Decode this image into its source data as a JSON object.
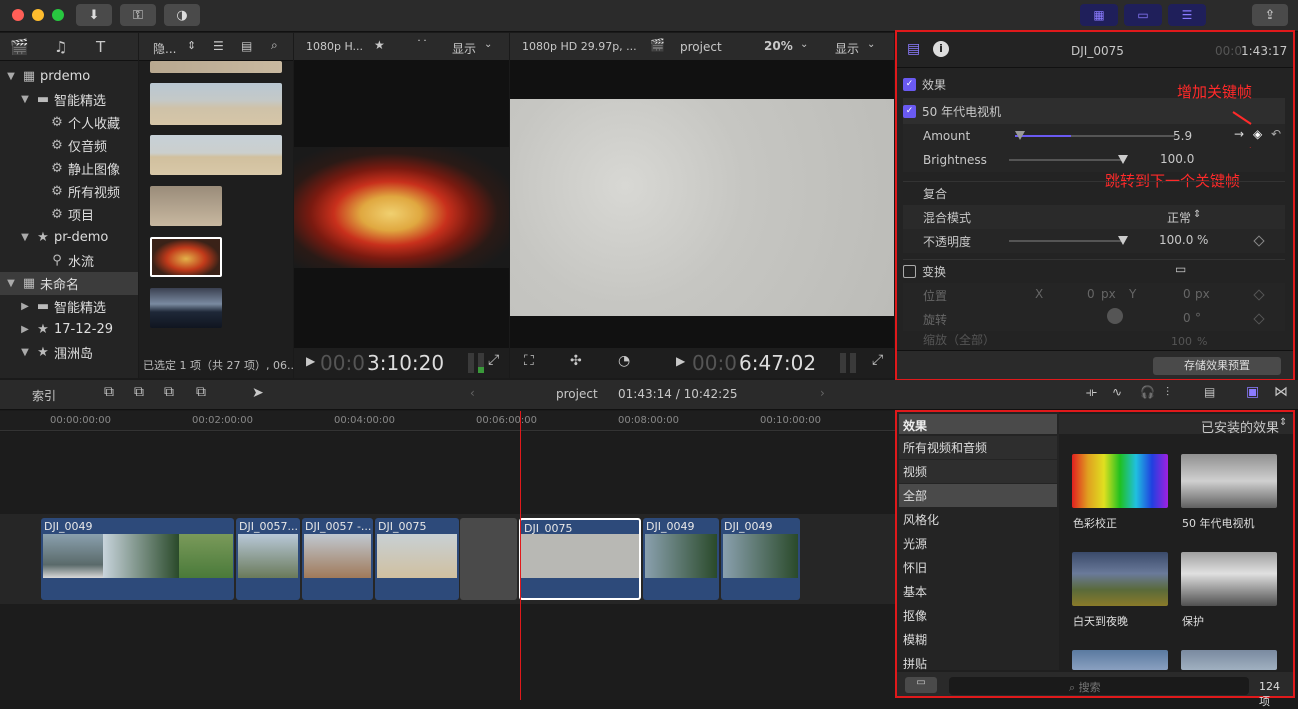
{
  "toolbar": {
    "buttons": [
      "download-icon",
      "key-icon",
      "clock-icon"
    ],
    "share": "share-icon"
  },
  "library": {
    "tools": [
      "clapboard-icon",
      "music-icon",
      "title-icon"
    ],
    "items": [
      {
        "label": "prdemo",
        "indent": 0,
        "expanded": true,
        "icon": "grid"
      },
      {
        "label": "智能精选",
        "indent": 1,
        "expanded": true,
        "icon": "folder"
      },
      {
        "label": "个人收藏",
        "indent": 2,
        "icon": "gear"
      },
      {
        "label": "仅音频",
        "indent": 2,
        "icon": "gear"
      },
      {
        "label": "静止图像",
        "indent": 2,
        "icon": "gear"
      },
      {
        "label": "所有视频",
        "indent": 2,
        "icon": "gear"
      },
      {
        "label": "项目",
        "indent": 2,
        "icon": "gear"
      },
      {
        "label": "pr-demo",
        "indent": 1,
        "expanded": true,
        "icon": "star"
      },
      {
        "label": "水流",
        "indent": 2,
        "icon": "key"
      },
      {
        "label": "未命名",
        "indent": 0,
        "expanded": true,
        "icon": "grid",
        "selected": true
      },
      {
        "label": "智能精选",
        "indent": 1,
        "expanded": false,
        "icon": "folder"
      },
      {
        "label": "17-12-29",
        "indent": 1,
        "expanded": false,
        "icon": "star"
      },
      {
        "label": "涠洲岛",
        "indent": 1,
        "expanded": true,
        "icon": "star"
      }
    ]
  },
  "browser": {
    "hide_label": "隐...",
    "status": "已选定 1 项（共 27 项）, 06..."
  },
  "viewer_left": {
    "format": "1080p H...",
    "display": "显示",
    "timecode_dim": "00:0",
    "timecode": "3:10:20"
  },
  "viewer_right": {
    "format": "1080p HD 29.97p, ...",
    "project": "project",
    "zoom": "20%",
    "display": "显示",
    "timecode_dim": "00:0",
    "timecode": "6:47:02"
  },
  "inspector": {
    "clip_name": "DJI_0075",
    "time_dim": "00:0",
    "time": "1:43:17",
    "effects_section": "效果",
    "effect_name": "50 年代电视机",
    "amount_label": "Amount",
    "amount_value": "5.9",
    "amount_fraction": 0.59,
    "brightness_label": "Brightness",
    "brightness_value": "100.0",
    "composite_section": "复合",
    "blend_label": "混合模式",
    "blend_value": "正常",
    "opacity_label": "不透明度",
    "opacity_value": "100.0",
    "opacity_unit": "%",
    "transform_section": "变换",
    "position_label": "位置",
    "pos_x_label": "X",
    "pos_x": "0",
    "pos_x_unit": "px",
    "pos_y_label": "Y",
    "pos_y": "0",
    "pos_y_unit": "px",
    "rotation_label": "旋转",
    "rotation_value": "0",
    "rotation_unit": "°",
    "scale_label": "缩放（全部）",
    "scale_value": "100",
    "scale_unit": "%",
    "save_button": "存储效果预置",
    "annotation_add": "增加关键帧",
    "annotation_next": "跳转到下一个关键帧"
  },
  "timeline_bar": {
    "index": "索引",
    "project": "project",
    "time": "01:43:14 / 10:42:25"
  },
  "ruler": [
    "00:00:00:00",
    "00:02:00:00",
    "00:04:00:00",
    "00:06:00:00",
    "00:08:00:00",
    "00:10:00:00"
  ],
  "clips": [
    "DJI_0049",
    "DJI_0057...",
    "DJI_0057 -...",
    "DJI_0075",
    "DJI_0075",
    "DJI_0049",
    "DJI_0049"
  ],
  "effects_browser": {
    "header": "效果",
    "installed": "已安装的效果",
    "categories": [
      "所有视频和音频",
      "视频",
      "全部",
      "风格化",
      "光源",
      "怀旧",
      "基本",
      "抠像",
      "模糊",
      "拼贴"
    ],
    "items": [
      "色彩校正",
      "50 年代电视机",
      "白天到夜晚",
      "保护"
    ],
    "search_placeholder": "搜索",
    "count": "124 项"
  }
}
